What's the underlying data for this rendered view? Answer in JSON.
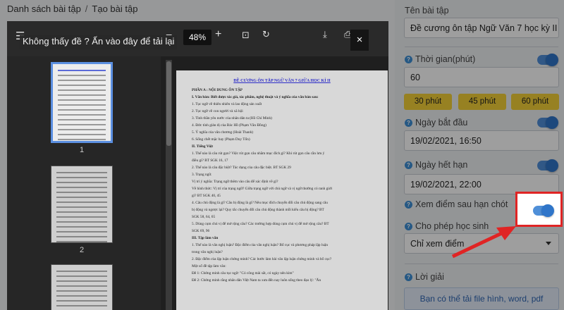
{
  "breadcrumb": {
    "item1": "Danh sách bài tập",
    "separator": "/",
    "item2": "Tạo bài tập"
  },
  "form": {
    "title_label": "Tên bài tập",
    "title_value": "Đề cương ôn tập Ngữ Văn 7 học kỳ II",
    "time_label": "Thời gian(phút)",
    "time_value": "60",
    "chips": [
      "30 phút",
      "45 phút",
      "60 phút"
    ],
    "start_label": "Ngày bắt đầu",
    "start_value": "19/02/2021, 16:50",
    "end_label": "Ngày hết hạn",
    "end_value": "19/02/2021, 22:00",
    "view_score_label": "Xem điểm sau hạn chót",
    "allow_label": "Cho phép học sinh",
    "allow_value": "Chỉ xem điểm",
    "solution_label": "Lời giải",
    "upload_label": "Bạn có thể tải file hình, word, pdf"
  },
  "viewer": {
    "zoom": "48%",
    "tip": "Không thấy đề ? Ấn vào đây để tải lại",
    "close": "×",
    "thumb_numbers": [
      "1",
      "2"
    ]
  },
  "doc": {
    "title": "ĐỀ CƯƠNG ÔN TẬP NGỮ VĂN 7 GIỮA HỌC KÌ II",
    "lines": [
      "PHẦN A : NỘI DUNG ÔN TẬP",
      "I. Văn bản: Biết được tác giả, tác phẩm, nghệ thuật và ý nghĩa của văn bản sau:",
      "1. Tục ngữ về thiên nhiên và lao động sản xuất",
      "2. Tục ngữ về con người và xã hội",
      "3. Tinh thần yêu nước của nhân dân ta (Hồ Chí Minh)",
      "4. Đức tính giản dị của Bác Hồ (Phạm Văn Đồng)",
      "5. Ý nghĩa của văn chương (Hoài Thanh)",
      "6. Sống chết mặc bay (Phạm Duy Tốn)",
      "II. Tiếng Việt",
      "1. Thế nào là câu rút gọn? Việc rút gọn câu nhằm mục đích gì? Khi rút gọn câu cần lưu ý",
      "điều gì? BT SGK 16, 17",
      "2. Thế nào là câu đặc biệt? Tác dụng của câu đặc biệt. BT SGK 29",
      "3. Trạng ngữ.",
      "Vị trí ý nghĩa: Trạng ngữ thêm vào câu để xác định về gì?",
      "Về hình thức: Vị trí của trạng ngữ? Giữa trạng ngữ với chủ ngữ và vị ngữ thường có ranh giới",
      "gì? BT SGK 40, 45",
      "4. Câu chủ động là gì? Câu bị động là gì? Nêu mục đích chuyển đổi câu chủ động sang câu",
      "bị động và ngược lại? Quy tắc chuyển đổi câu chủ động thành mỗi kiểu câu bị động? BT",
      "SGK 58, 64, 65",
      "5. Dùng cụm chủ vị để mở rộng câu? Các trường hợp dùng cụm chủ vị để mở rộng câu? BT",
      "SGK 69, 96",
      "III. Tập làm văn",
      "1. Thế nào là văn nghị luận? Đặc điểm của văn nghị luận? Bố cục và phương pháp lập luận",
      "trong văn nghị luận?",
      "2. Đặc điểm của lập luận chứng minh? Các bước làm bài văn lập luận chứng minh và bố cục?",
      "Một số đề tập làm văn:",
      "Đề 1: Chứng minh câu tục ngữ: \"Có công mài sắt, có ngày nên kim\"",
      "Đề 2: Chứng minh rằng nhân dân Việt Nam ta xưa đến nay luôn sống theo đạo lý: \"Ăn"
    ]
  }
}
